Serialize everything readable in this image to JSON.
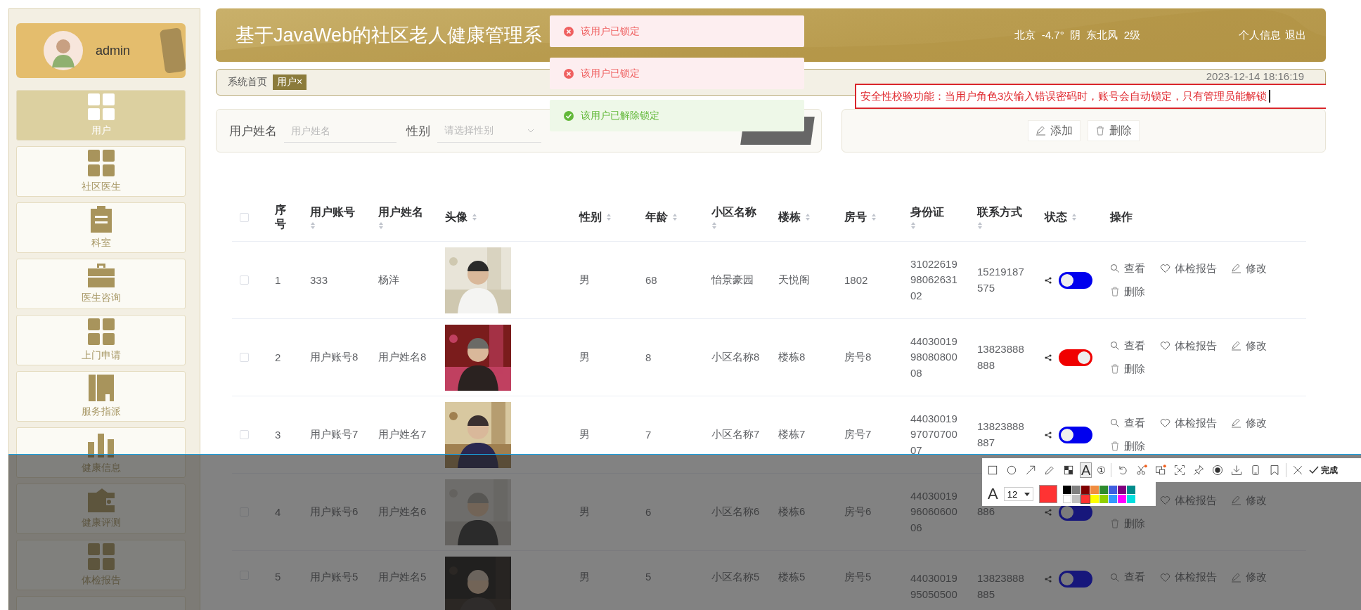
{
  "sidebar": {
    "user": {
      "name": "admin"
    },
    "items": [
      {
        "label": "用户",
        "selected": true
      },
      {
        "label": "社区医生",
        "selected": false
      },
      {
        "label": "科室",
        "selected": false
      },
      {
        "label": "医生咨询",
        "selected": false
      },
      {
        "label": "上门申请",
        "selected": false
      },
      {
        "label": "服务指派",
        "selected": false
      },
      {
        "label": "健康信息",
        "selected": false
      },
      {
        "label": "健康评测",
        "selected": false
      },
      {
        "label": "体检报告",
        "selected": false
      }
    ]
  },
  "header": {
    "title": "基于JavaWeb的社区老人健康管理系",
    "weather": "北京  -4.7°  阴  东北风  2级",
    "links": [
      "个人信息",
      "退出"
    ]
  },
  "breadcrumb": {
    "home": "系统首页",
    "tag": "用户",
    "tag_close": "×",
    "datetime": "2023-12-14 18:16:19"
  },
  "annotation": "安全性校验功能：当用户角色3次输入错误密码时，账号会自动锁定，只有管理员能解锁",
  "search": {
    "fields": [
      {
        "label": "用户姓名",
        "placeholder": "用户姓名",
        "kind": "input"
      },
      {
        "label": "性别",
        "placeholder": "请选择性别",
        "kind": "select"
      }
    ]
  },
  "actions": [
    {
      "kind": "add",
      "label": "添加"
    },
    {
      "kind": "delete",
      "label": "删除"
    }
  ],
  "toasts": [
    {
      "kind": "error",
      "text": "该用户已锁定"
    },
    {
      "kind": "error",
      "text": "该用户已锁定"
    },
    {
      "kind": "success",
      "text": "该用户已解除锁定"
    }
  ],
  "table": {
    "header_checked": false,
    "columns": [
      {
        "label": "序号",
        "sortable": false
      },
      {
        "label": "用户账号",
        "sortable": true
      },
      {
        "label": "用户姓名",
        "sortable": true
      },
      {
        "label": "头像",
        "sortable": true
      },
      {
        "label": "性别",
        "sortable": true
      },
      {
        "label": "年龄",
        "sortable": true
      },
      {
        "label": "小区名称",
        "sortable": true
      },
      {
        "label": "楼栋",
        "sortable": true
      },
      {
        "label": "房号",
        "sortable": true
      },
      {
        "label": "身份证",
        "sortable": true
      },
      {
        "label": "联系方式",
        "sortable": true
      },
      {
        "label": "状态",
        "sortable": true
      },
      {
        "label": "操作",
        "sortable": false
      }
    ],
    "rows": [
      {
        "checked": false,
        "cells": [
          "1",
          "333",
          "杨洋",
          "",
          "男",
          "68",
          "怡景豪园",
          "天悦阁",
          "1802",
          "3102261998062631 02",
          "15219187575"
        ],
        "on": false,
        "ops": [
          {
            "kind": "view",
            "label": "查看"
          },
          {
            "kind": "report",
            "label": "体检报告"
          },
          {
            "kind": "edit",
            "label": "修改"
          },
          {
            "kind": "delete",
            "label": "删除"
          }
        ]
      },
      {
        "checked": false,
        "cells": [
          "2",
          "用户账号8",
          "用户姓名8",
          "",
          "男",
          "8",
          "小区名称8",
          "楼栋8",
          "房号8",
          "4403001998080800 08",
          "13823888888"
        ],
        "on": true,
        "ops": [
          {
            "kind": "view",
            "label": "查看"
          },
          {
            "kind": "report",
            "label": "体检报告"
          },
          {
            "kind": "edit",
            "label": "修改"
          },
          {
            "kind": "delete",
            "label": "删除"
          }
        ]
      },
      {
        "checked": false,
        "cells": [
          "3",
          "用户账号7",
          "用户姓名7",
          "",
          "男",
          "7",
          "小区名称7",
          "楼栋7",
          "房号7",
          "4403001997070700 07",
          "13823888887"
        ],
        "on": false,
        "ops": [
          {
            "kind": "view",
            "label": "查看"
          },
          {
            "kind": "report",
            "label": "体检报告"
          },
          {
            "kind": "edit",
            "label": "修改"
          },
          {
            "kind": "delete",
            "label": "删除"
          }
        ]
      },
      {
        "checked": false,
        "cells": [
          "4",
          "用户账号6",
          "用户姓名6",
          "",
          "男",
          "6",
          "小区名称6",
          "楼栋6",
          "房号6",
          "4403001996060600 06",
          "886"
        ],
        "on": false,
        "ops": [
          {
            "kind": "report",
            "label": "体检报告"
          },
          {
            "kind": "edit",
            "label": "修改"
          },
          {
            "kind": "delete",
            "label": "删除"
          }
        ]
      },
      {
        "checked": false,
        "cells": [
          "5",
          "用户账号5",
          "用户姓名5",
          "",
          "男",
          "5",
          "小区名称5",
          "楼栋5",
          "房号5",
          "4403001995050500",
          "13823888885"
        ],
        "on": false,
        "ops": [
          {
            "kind": "view",
            "label": "查看"
          },
          {
            "kind": "report",
            "label": "体检报告"
          },
          {
            "kind": "edit",
            "label": "修改"
          }
        ]
      }
    ]
  },
  "snip_toolbar": {
    "tools": [
      {
        "kind": "rect",
        "selected": false
      },
      {
        "kind": "ellipse",
        "selected": false
      },
      {
        "kind": "arrow",
        "selected": false
      },
      {
        "kind": "pencil",
        "selected": false
      },
      {
        "kind": "mosaic",
        "selected": false
      },
      {
        "kind": "text",
        "label": "A",
        "selected": true
      },
      {
        "kind": "number",
        "label": "①",
        "selected": false
      },
      {
        "kind": "undo",
        "selected": false
      },
      {
        "kind": "cut",
        "selected": false
      },
      {
        "kind": "translate",
        "selected": false
      },
      {
        "kind": "scan",
        "selected": false
      },
      {
        "kind": "pin",
        "selected": false
      },
      {
        "kind": "record",
        "selected": false
      },
      {
        "kind": "download",
        "selected": false
      },
      {
        "kind": "phone",
        "selected": false
      },
      {
        "kind": "bookmark",
        "selected": false
      },
      {
        "kind": "close",
        "selected": false
      }
    ],
    "done": "完成",
    "font_label": "A",
    "font_size": "12",
    "swatches": [
      {
        "color": "#000000",
        "selected": false
      },
      {
        "color": "#808080",
        "selected": false
      },
      {
        "color": "#800000",
        "selected": false
      },
      {
        "color": "#f08c40",
        "selected": false
      },
      {
        "color": "#2e8b2e",
        "selected": false
      },
      {
        "color": "#3f5fe0",
        "selected": false
      },
      {
        "color": "#800080",
        "selected": false
      },
      {
        "color": "#008b8b",
        "selected": false
      },
      {
        "color": "#ffffff",
        "selected": false
      },
      {
        "color": "#c0c0c0",
        "selected": false
      },
      {
        "color": "#ff3333",
        "selected": true
      },
      {
        "color": "#ffff00",
        "selected": false
      },
      {
        "color": "#90d000",
        "selected": false
      },
      {
        "color": "#3399ff",
        "selected": false
      },
      {
        "color": "#ff00ff",
        "selected": false
      },
      {
        "color": "#00e0e0",
        "selected": false
      }
    ]
  }
}
